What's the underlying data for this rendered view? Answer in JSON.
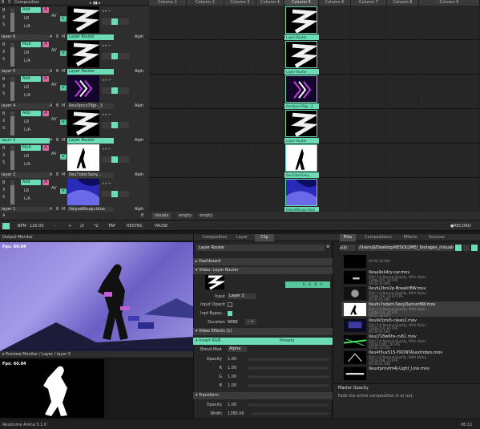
{
  "header": {
    "layer_label": "Composition",
    "columns": [
      "Column 1",
      "Column 2",
      "Column 3",
      "Column 4",
      "Column 5",
      "Column 6",
      "Column 7",
      "Column 8",
      "Column 9"
    ]
  },
  "layers": [
    {
      "name": "layer 6",
      "mode": "Add",
      "clip": "Layer Router",
      "col5_clip": "Layer Router",
      "thumb": "zigzag"
    },
    {
      "name": "layer 5",
      "mode": "Mult",
      "clip": "Layer Router",
      "col5_clip": "Layer Router",
      "thumb": "zigzag"
    },
    {
      "name": "layer 4",
      "mode": "Add",
      "clip": "0eu0prcx78jp-_3",
      "col5_clip": "0eu0prcx78jp-_3",
      "thumb": "chevrons"
    },
    {
      "name": "layer 3",
      "mode": "Add",
      "clip": "Layer Router",
      "col5_clip": "Layer Router",
      "thumb": "zigzag"
    },
    {
      "name": "layer 2",
      "mode": "Mult",
      "clip": "0eu7obd-Sexy...",
      "col5_clip": "0eu7obd-Sexy...",
      "thumb": "dancer"
    },
    {
      "name": "layer 1",
      "mode": "Add",
      "clip": "0elyad6kuqu-blue",
      "col5_clip": "0elyad6kuqu-blue",
      "thumb": "blue"
    }
  ],
  "layer_controls": {
    "b": "B",
    "x": "X",
    "s": "S",
    "lr": "LR",
    "lrb": "L/A",
    "av": "AV",
    "v": "V",
    "a": "A",
    "bb": "B",
    "m": "M",
    "alph": "Alph"
  },
  "deck": {
    "a": "A",
    "b": "B",
    "tabs": [
      "visuals",
      "empty",
      "empty"
    ]
  },
  "transport": {
    "bpm_label": "BPM",
    "bpm_value": "120.00",
    "minus": "-",
    "plus": "+",
    "half": "/2",
    "double": "*2",
    "tap": "TAP",
    "resync": "RESYNC",
    "pause": "PAUSE",
    "record": "●RECORD"
  },
  "output": {
    "title": "Output Monitor",
    "fps": "Fps: 60.04"
  },
  "preview": {
    "title": "Preview Monitor / Layer / layer 5",
    "fps": "Fps: 60.04"
  },
  "center_tabs": [
    "Composition",
    "Layer",
    "Clip"
  ],
  "clip_panel": {
    "name_field": "Layer Router",
    "dashboard": "Dashboard",
    "video_source": "Video: Layer Router",
    "input_label": "Input",
    "input_value": "Layer 2",
    "input_opacity_label": "Input Opacity",
    "bypass_label": "Inpt Bypas...",
    "duration_label": "Duration",
    "duration_value": "5000",
    "effects_label": "Video Effects (1)",
    "invert_label": "Invert RGB",
    "presets_label": "Presets",
    "blend_label": "Blend Mode",
    "blend_value": "Alpha",
    "opacity_label": "Opacity",
    "opacity_value": "1.00",
    "r_label": "R",
    "r_value": "1.00",
    "g_label": "G",
    "g_value": "1.00",
    "b_label": "B",
    "b_value": "1.00",
    "transform_label": "Transform",
    "t_opacity_label": "Opacity",
    "t_opacity_value": "1.00",
    "width_label": "Width",
    "width_value": "1280.00",
    "rgba": [
      "R",
      "G",
      "B",
      "A"
    ]
  },
  "right_tabs": [
    "Files",
    "Compositions",
    "Effects",
    "Sources"
  ],
  "browser": {
    "up_label": "Up",
    "path": "/Users/jl/Desktop/RESOLUME/_footages_/visuals",
    "files": [
      {
        "name": "",
        "meta1": "00:00:18.000",
        "meta2": "",
        "meta3": "",
        "thumb": "black"
      },
      {
        "name": "0eua9xk4ry-car.mov",
        "meta1": "DXV 3.0 Normal Quality, With Alpha",
        "meta2": "1280x720, 30 FPS",
        "meta3": "00:00:10.000",
        "thumb": "car"
      },
      {
        "name": "0eufu2bro2p-BreakitBW.mov",
        "meta1": "DXV 3.0 Normal Quality, With Alpha",
        "meta2": "1280x720, 29.97 FPS",
        "meta3": "00:00:45.090",
        "thumb": "bw"
      },
      {
        "name": "0eufu7odect-SexyDancerBW.mov",
        "meta1": "DXV 3.0 Normal Quality, With Alpha",
        "meta2": "1280x720, 24 FPS",
        "meta3": "00:01:18.417",
        "thumb": "dancer"
      },
      {
        "name": "0eulik3zre5-clean2.mov",
        "meta1": "DXV 3.0 Normal Quality, With Alpha",
        "meta2": "1280x720, 60 FPS",
        "meta3": "00:00:02.000",
        "thumb": "clean"
      },
      {
        "name": "0euj718w6hs-cv61.mov",
        "meta1": "DXV 3.0 Normal Quality, With Alpha",
        "meta2": "1920x1080, 30 FPS",
        "meta3": "00:00:10.100",
        "thumb": "green"
      },
      {
        "name": "0eu4t5ux515-FRONTALextrobos.mov",
        "meta1": "DXV 3.0 Normal Quality, With Alpha",
        "meta2": "1024x768, 25 FPS",
        "meta3": "00:00:01.040",
        "thumb": "strobe"
      },
      {
        "name": "0eusfprnvfm4j-Light_Line.mov",
        "meta1": "",
        "meta2": "",
        "meta3": "",
        "thumb": "line"
      }
    ]
  },
  "master": {
    "title": "Master Opacity",
    "desc": "Fade the entire composition in or out."
  },
  "status": {
    "app": "Resolume Arena 5.1.0",
    "time": "06:11"
  },
  "colors": {
    "accent": "#6cdcb6",
    "pink": "#d46aa3",
    "bg": "#1a1a1a"
  }
}
